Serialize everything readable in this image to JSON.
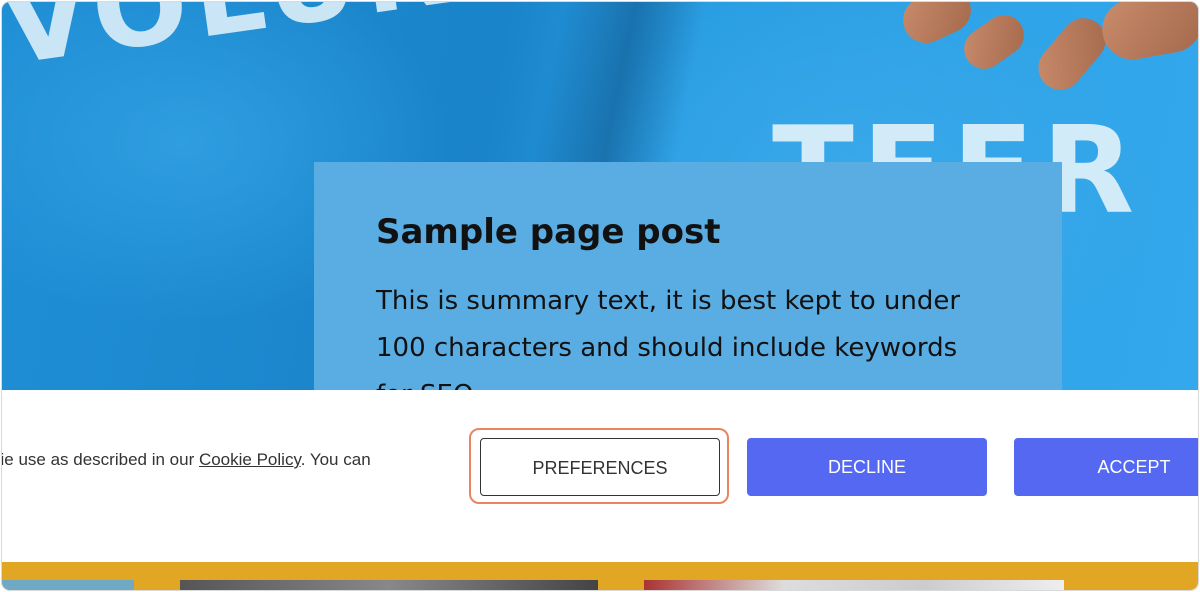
{
  "post": {
    "title": "Sample page post",
    "summary": "This is summary text, it is best kept to under 100 characters and should include keywords for SEO"
  },
  "hero": {
    "shirt_text_left": "VOLUNTEER",
    "shirt_text_right": "TEER"
  },
  "cookie_banner": {
    "text_before": "kie use as described in our ",
    "link_text": "Cookie Policy",
    "text_after": ". You can",
    "buttons": {
      "preferences": "PREFERENCES",
      "decline": "DECLINE",
      "accept": "ACCEPT"
    }
  },
  "colors": {
    "button_primary": "#5468f2",
    "highlight_ring": "#e9865f",
    "card_bg": "#5aade3",
    "strip_bg": "#e1a724"
  }
}
